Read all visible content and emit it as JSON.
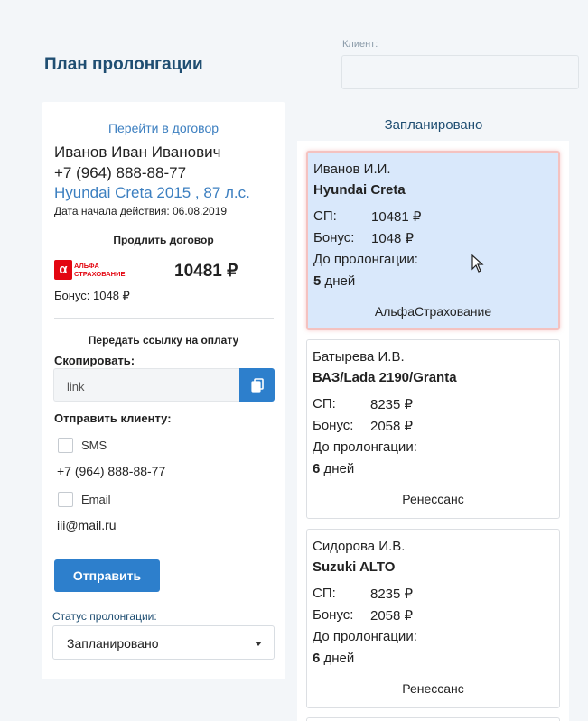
{
  "header": {
    "title": "План пролонгации"
  },
  "client_filter": {
    "label": "Клиент:",
    "value": ""
  },
  "left": {
    "goto_link": "Перейти в договор",
    "client_name": "Иванов Иван Иванович",
    "client_phone": "+7 (964) 888-88-77",
    "client_car": "Hyundai Creta 2015 , 87 л.с.",
    "start_date": "Дата начала действия: 06.08.2019",
    "extend_title": "Продлить договор",
    "insurer_logo_mark": "α",
    "insurer_logo_text": "АЛЬФА\nСТРАХОВАНИЕ",
    "extend_price": "10481 ₽",
    "bonus": "Бонус: 1048 ₽",
    "pay_title": "Передать ссылку на оплату",
    "copy_label": "Скопировать:",
    "link_value": "link",
    "send_label": "Отправить клиенту:",
    "sms_label": "SMS",
    "sms_phone": "+7 (964) 888-88-77",
    "email_label": "Email",
    "email_value": "iii@mail.ru",
    "send_button": "Отправить",
    "status_label": "Статус пролонгации:",
    "status_value": "Запланировано"
  },
  "column": {
    "title": "Запланировано",
    "cards": [
      {
        "name": "Иванов И.И.",
        "car": "Hyundai Creta",
        "sp_label": "СП:",
        "sp": "10481 ₽",
        "bonus_label": "Бонус:",
        "bonus": "1048   ₽",
        "until_label": "До пролонгации:",
        "days_num": "5",
        "days_word": "дней",
        "insurer": "АльфаСтрахование",
        "active": true
      },
      {
        "name": "Батырева И.В.",
        "car": "ВАЗ/Lada 2190/Granta",
        "sp_label": "СП:",
        "sp": "8235 ₽",
        "bonus_label": "Бонус:",
        "bonus": "2058 ₽",
        "until_label": "До пролонгации:",
        "days_num": "6",
        "days_word": "дней",
        "insurer": "Ренессанс",
        "active": false
      },
      {
        "name": "Сидорова И.В.",
        "car": "Suzuki ALTO",
        "sp_label": "СП:",
        "sp": "8235 ₽",
        "bonus_label": "Бонус:",
        "bonus": "2058 ₽",
        "until_label": "До пролонгации:",
        "days_num": "6",
        "days_word": "дней",
        "insurer": "Ренессанс",
        "active": false
      }
    ]
  },
  "colors": {
    "accent": "#2d7fcc",
    "title": "#1f4e72",
    "link": "#3c7fc0",
    "active_card": "#d9e8fb",
    "alfa_red": "#e30611"
  }
}
